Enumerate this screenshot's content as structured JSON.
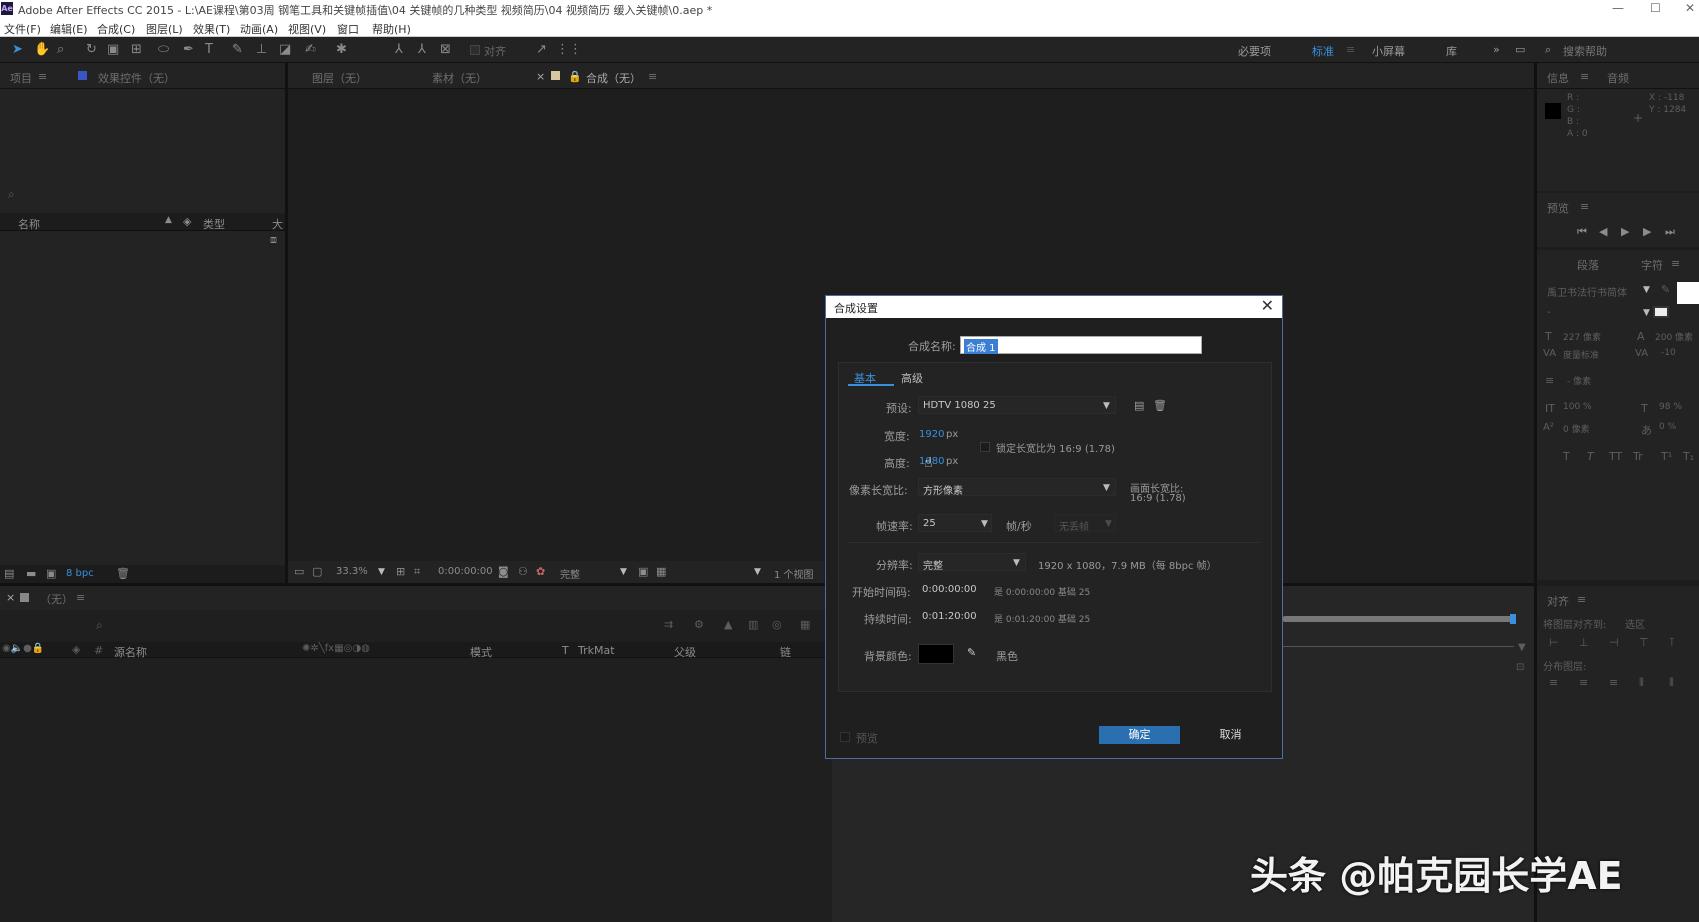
{
  "window": {
    "title": "Adobe After Effects CC 2015 - L:\\AE课程\\第03周 钢笔工具和关键帧插值\\04 关键帧的几种类型 视频简历\\04 视频简历 缓入关键帧\\0.aep *",
    "minimize": "—",
    "maximize": "☐",
    "close": "✕"
  },
  "menu": [
    "文件(F)",
    "编辑(E)",
    "合成(C)",
    "图层(L)",
    "效果(T)",
    "动画(A)",
    "视图(V)",
    "窗口",
    "帮助(H)"
  ],
  "toolbar": {
    "snap": "对齐",
    "workspaces": [
      "必要项",
      "标准",
      "小屏幕",
      "库"
    ],
    "search_placeholder": "搜索帮助",
    "active_workspace": "标准"
  },
  "project_panel": {
    "tab": "项目",
    "effects_tab": "效果控件（无）",
    "col_name": "名称",
    "col_type": "类型",
    "col_size": "大",
    "bpc": "8 bpc"
  },
  "viewer": {
    "tabs": [
      "图层（无）",
      "素材（无）",
      "合成（无）"
    ],
    "zoom": "33.3%",
    "timecode": "0:00:00:00",
    "quality": "完整",
    "views": "1 个视图"
  },
  "info_panel": {
    "tab": "信息",
    "audio_tab": "音频",
    "r": "R :",
    "g": "G :",
    "b": "B :",
    "a": "A : 0",
    "x": "X : -118",
    "y": "Y : 1284"
  },
  "preview_panel": {
    "tab": "预览"
  },
  "char_panel": {
    "tab_para": "段落",
    "tab_char": "字符",
    "font": "禹卫书法行书简体",
    "size": "227 像素",
    "leading": "200 像素",
    "kerning": "度量标准",
    "tracking": "-10",
    "stroke": "- 像素",
    "vscale": "100 %",
    "hscale": "98 %",
    "baseline": "0 像素",
    "tsume": "0 %",
    "styles": [
      "T",
      "T",
      "TT",
      "Tr",
      "T¹",
      "T₁"
    ]
  },
  "align_panel": {
    "tab": "对齐",
    "align_to_label": "将图层对齐到:",
    "align_to": "选区",
    "distribute": "分布图层:"
  },
  "timeline": {
    "comp": "（无）",
    "cols": [
      "源名称",
      "模式",
      "T",
      "TrkMat",
      "父级",
      "链"
    ]
  },
  "dialog": {
    "title": "合成设置",
    "close": "✕",
    "name_label": "合成名称:",
    "name_value": "合成 1",
    "tabs": [
      "基本",
      "高级"
    ],
    "preset_label": "预设:",
    "preset_value": "HDTV 1080 25",
    "width_label": "宽度:",
    "width_value": "1920",
    "width_unit": "px",
    "lock_label": "锁定长宽比为 16:9 (1.78)",
    "height_label": "高度:",
    "height_value": "1080",
    "height_unit": "px",
    "par_label": "像素长宽比:",
    "par_value": "方形像素",
    "far_label": "画面长宽比:",
    "far_value": "16:9 (1.78)",
    "fps_label": "帧速率:",
    "fps_value": "25",
    "fps_unit": "帧/秒",
    "drop_frame": "无丢帧",
    "res_label": "分辨率:",
    "res_value": "完整",
    "res_info": "1920 x 1080，7.9 MB（每 8bpc 帧）",
    "start_label": "开始时间码:",
    "start_value": "0:00:00:00",
    "start_info": "是 0:00:00:00  基础 25",
    "dur_label": "持续时间:",
    "dur_value": "0:01:20:00",
    "dur_info": "是 0:01:20:00  基础 25",
    "bg_label": "背景颜色:",
    "bg_color": "#000000",
    "bg_name": "黑色",
    "preview": "预览",
    "ok": "确定",
    "cancel": "取消"
  },
  "watermark": "头条 @帕克园长学AE"
}
